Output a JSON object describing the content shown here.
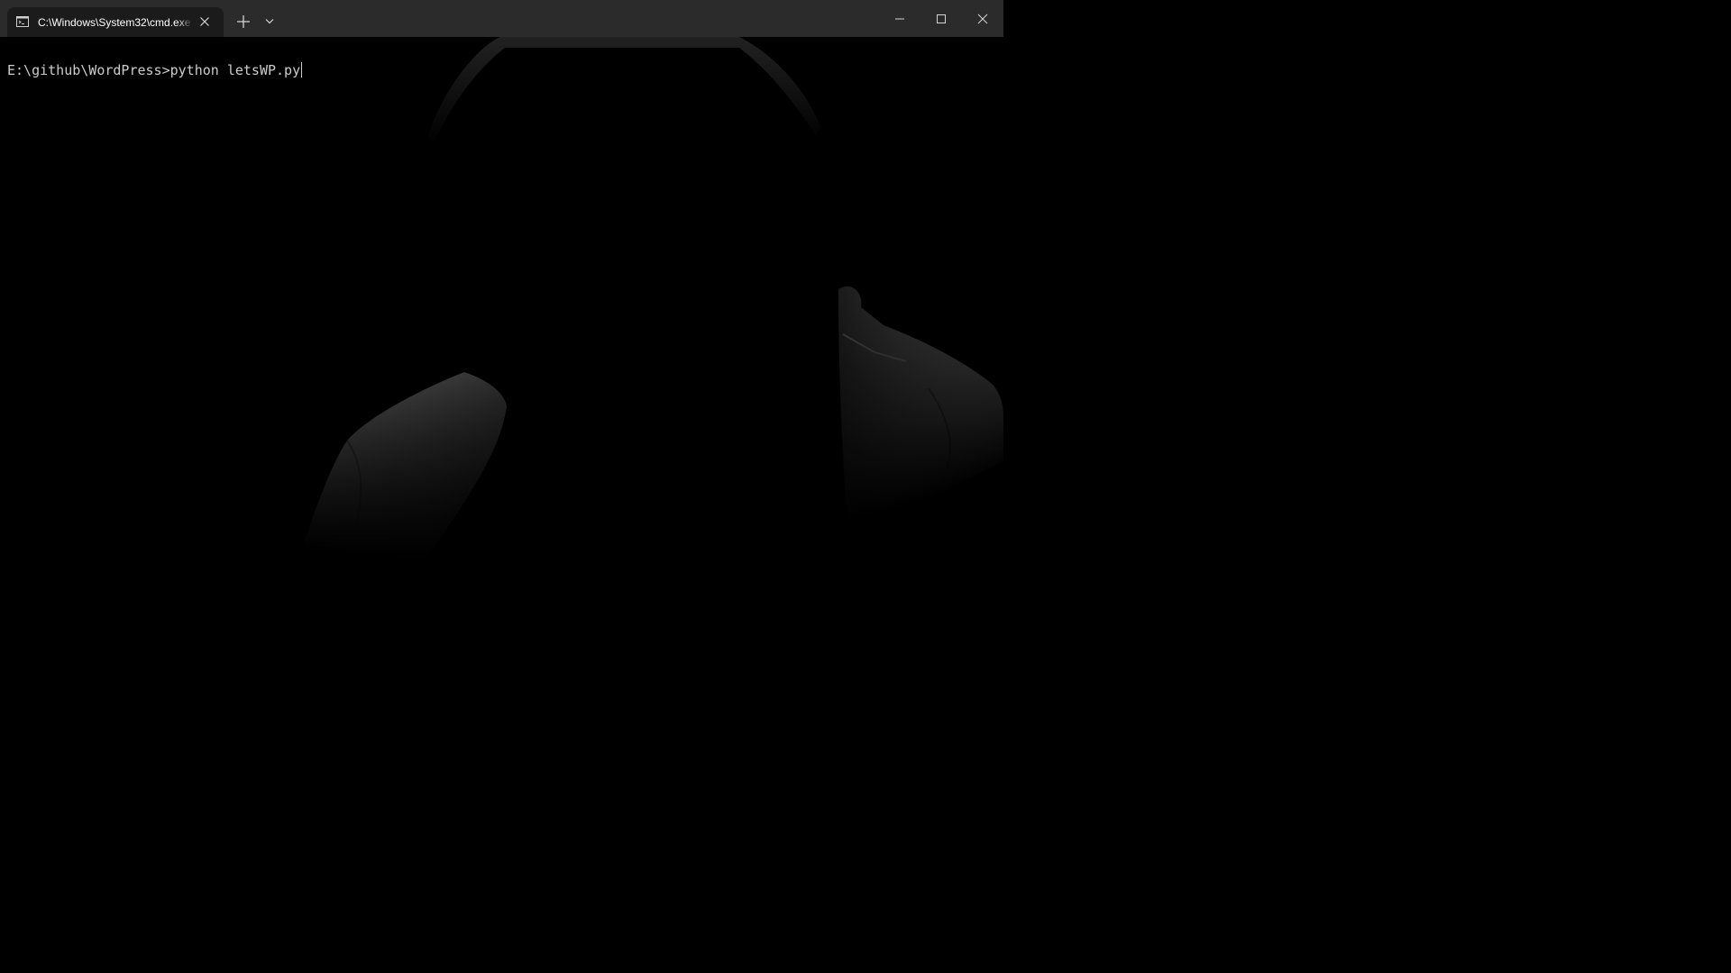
{
  "window": {
    "tab_title": "C:\\Windows\\System32\\cmd.exe",
    "icons": {
      "tab": "terminal-icon",
      "tab_close": "close-icon",
      "new_tab": "plus-icon",
      "dropdown": "chevron-down-icon",
      "minimize": "minimize-icon",
      "maximize": "maximize-icon",
      "close": "close-icon"
    }
  },
  "terminal": {
    "prompt": "E:\\github\\WordPress>",
    "command": "python letsWP.py"
  },
  "background_image": {
    "subject": "hooded-figure-silhouette"
  },
  "colors": {
    "titlebar": "#2b2b2b",
    "active_tab": "#1b1b1b",
    "terminal_bg": "#000000",
    "terminal_text": "#cccccc"
  }
}
